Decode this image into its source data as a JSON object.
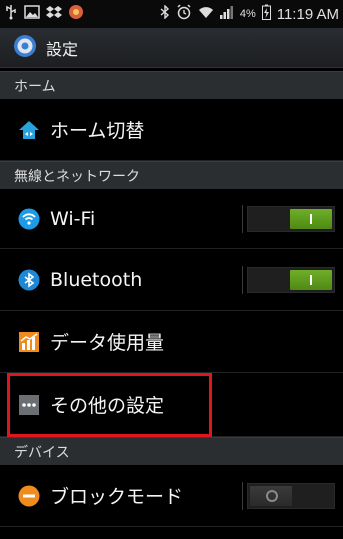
{
  "statusbar": {
    "time": "11:19 AM",
    "battery_percent": "4%",
    "left_icons": [
      "usb-icon",
      "image-icon",
      "dropbox-icon",
      "app-icon"
    ],
    "right_icons": [
      "bluetooth-icon",
      "alarm-icon",
      "wifi-icon",
      "signal-icon",
      "battery-icon"
    ]
  },
  "appbar": {
    "title": "設定",
    "icon": "gear-icon"
  },
  "sections": {
    "home": "ホーム",
    "network": "無線とネットワーク",
    "device": "デバイス"
  },
  "rows": {
    "home_switch": "ホーム切替",
    "wifi": "Wi-Fi",
    "bluetooth": "Bluetooth",
    "data_usage": "データ使用量",
    "more_settings": "その他の設定",
    "block_mode": "ブロックモード"
  },
  "toggles": {
    "wifi": true,
    "bluetooth": true,
    "block_mode": false
  },
  "colors": {
    "accent_green": "#5a9a1c",
    "highlight_red": "#e0161f",
    "wifi_blue": "#1e9be6",
    "block_orange": "#f08c1e"
  }
}
